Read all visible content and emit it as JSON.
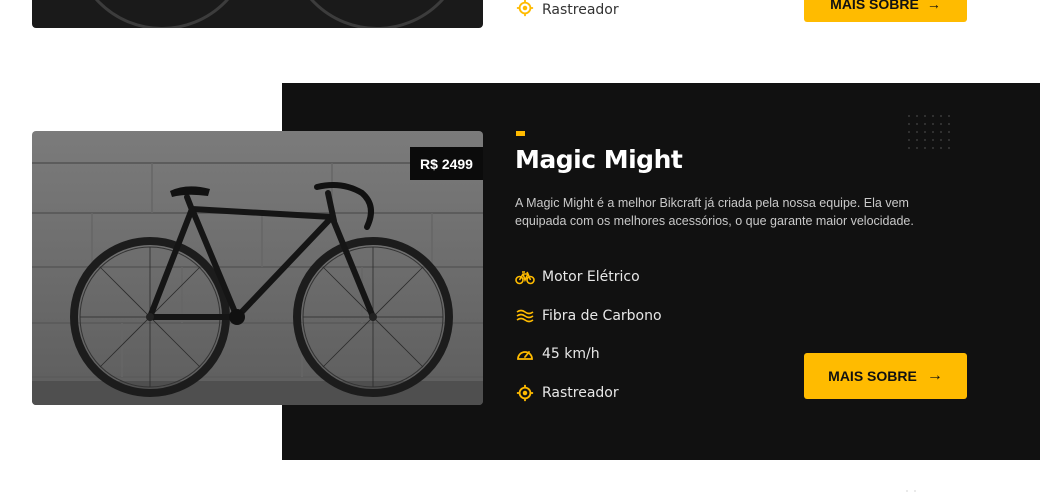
{
  "previous_card": {
    "feature_label": "Rastreador",
    "button_label": "MAIS SOBRE",
    "button_icon": "arrow-right-icon"
  },
  "product": {
    "price": "R$ 2499",
    "title": "Magic Might",
    "description": "A Magic Might é a melhor Bikcraft já criada pela nossa equipe. Ela vem equipada com os melhores acessórios, o que garante maior velocidade.",
    "features": [
      {
        "label": "Motor Elétrico",
        "icon": "bike-icon"
      },
      {
        "label": "Fibra de Carbono",
        "icon": "waves-icon"
      },
      {
        "label": "45 km/h",
        "icon": "speedometer-icon"
      },
      {
        "label": "Rastreador",
        "icon": "target-icon"
      }
    ],
    "button_label": "MAIS SOBRE",
    "button_icon": "arrow-right-icon"
  },
  "colors": {
    "accent": "#ffbb00",
    "dark_panel": "#111111",
    "price_tag": "#0b0b0b",
    "page_background": "#ffffff"
  }
}
